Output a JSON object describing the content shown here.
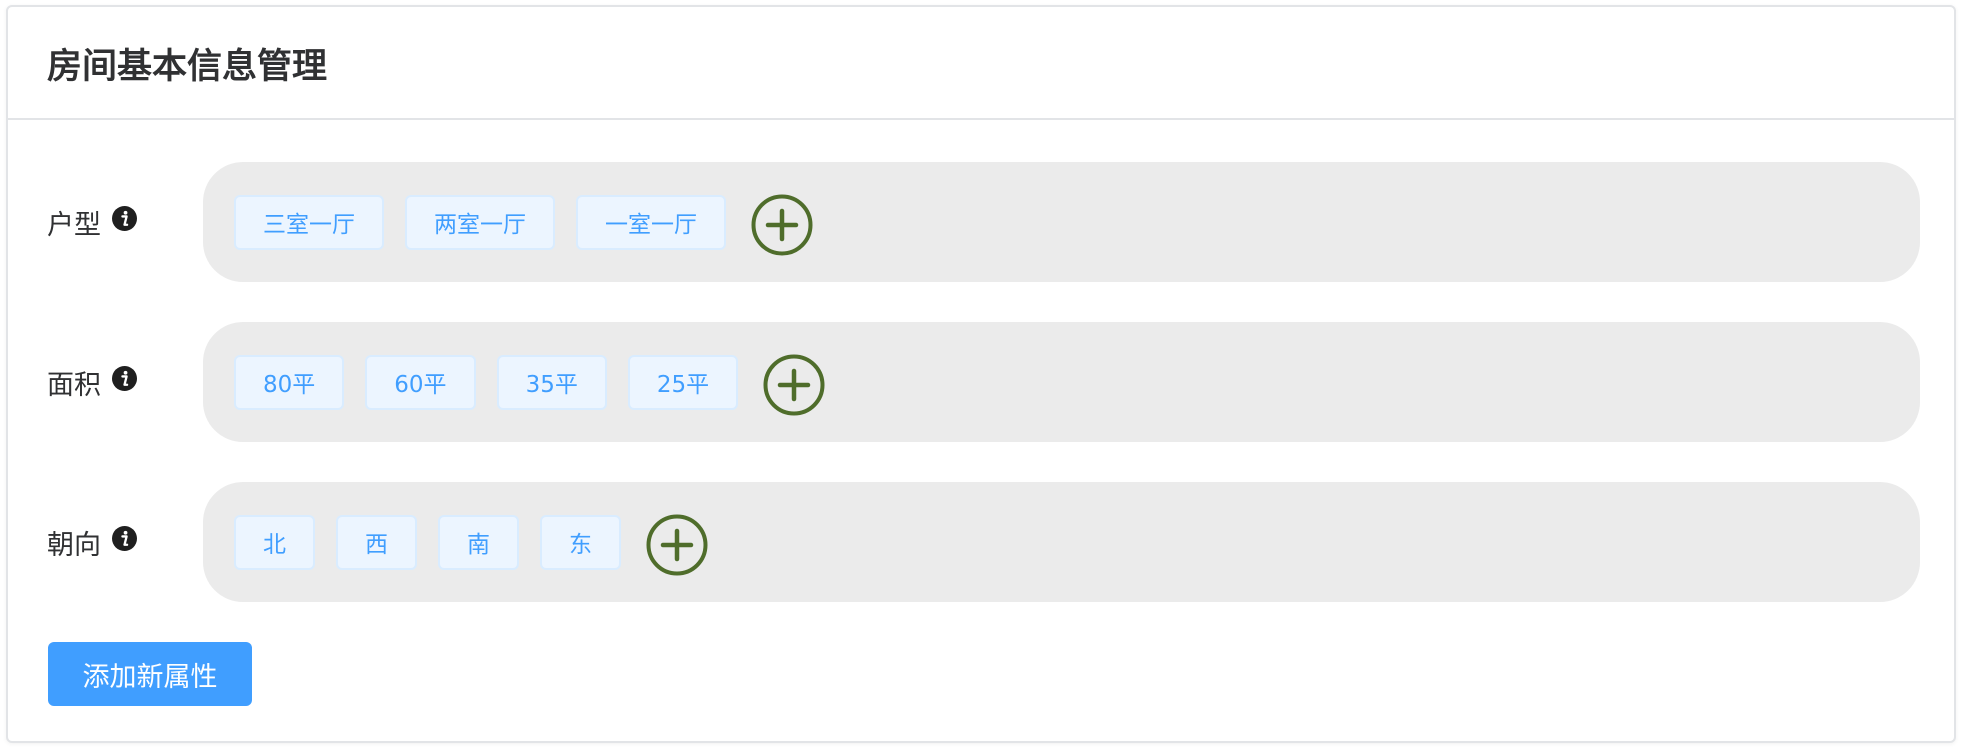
{
  "title": "房间基本信息管理",
  "rows": [
    {
      "label": "户型",
      "tags": [
        "三室一厅",
        "两室一厅",
        "一室一厅"
      ]
    },
    {
      "label": "面积",
      "tags": [
        "80平",
        "60平",
        "35平",
        "25平"
      ]
    },
    {
      "label": "朝向",
      "tags": [
        "北",
        "西",
        "南",
        "东"
      ]
    }
  ],
  "add_attribute_label": "添加新属性",
  "colors": {
    "primary": "#409eff",
    "tag_bg": "#ecf5ff",
    "tag_border": "#d9ecff",
    "row_bg": "#ebebeb",
    "add_icon": "#4f6d2b",
    "text": "#303133"
  },
  "icons": {
    "info": "info-icon",
    "add": "plus-circle-icon"
  }
}
